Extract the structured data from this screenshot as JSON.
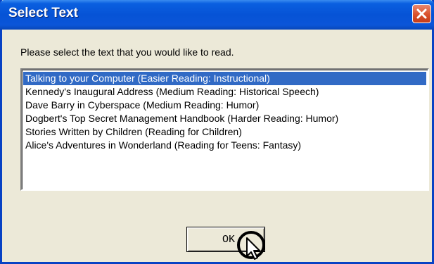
{
  "window": {
    "title": "Select Text"
  },
  "dialog": {
    "prompt": "Please select the text that you would like to read.",
    "items": [
      {
        "label": "Talking to your Computer (Easier Reading: Instructional)",
        "selected": true
      },
      {
        "label": "Kennedy's Inaugural Address (Medium Reading: Historical Speech)",
        "selected": false
      },
      {
        "label": "Dave Barry in Cyberspace (Medium Reading: Humor)",
        "selected": false
      },
      {
        "label": "Dogbert's Top Secret Management Handbook (Harder Reading: Humor)",
        "selected": false
      },
      {
        "label": "Stories Written by Children (Reading for Children)",
        "selected": false
      },
      {
        "label": "Alice's Adventures in Wonderland (Reading for Teens: Fantasy)",
        "selected": false
      }
    ],
    "ok_label": "OK"
  },
  "colors": {
    "titlebar": "#0653d6",
    "selection": "#316ac5",
    "close": "#d9512c",
    "face": "#ece9d8"
  },
  "icons": {
    "close": "close-icon",
    "cursor": "mouse-pointer-icon"
  }
}
